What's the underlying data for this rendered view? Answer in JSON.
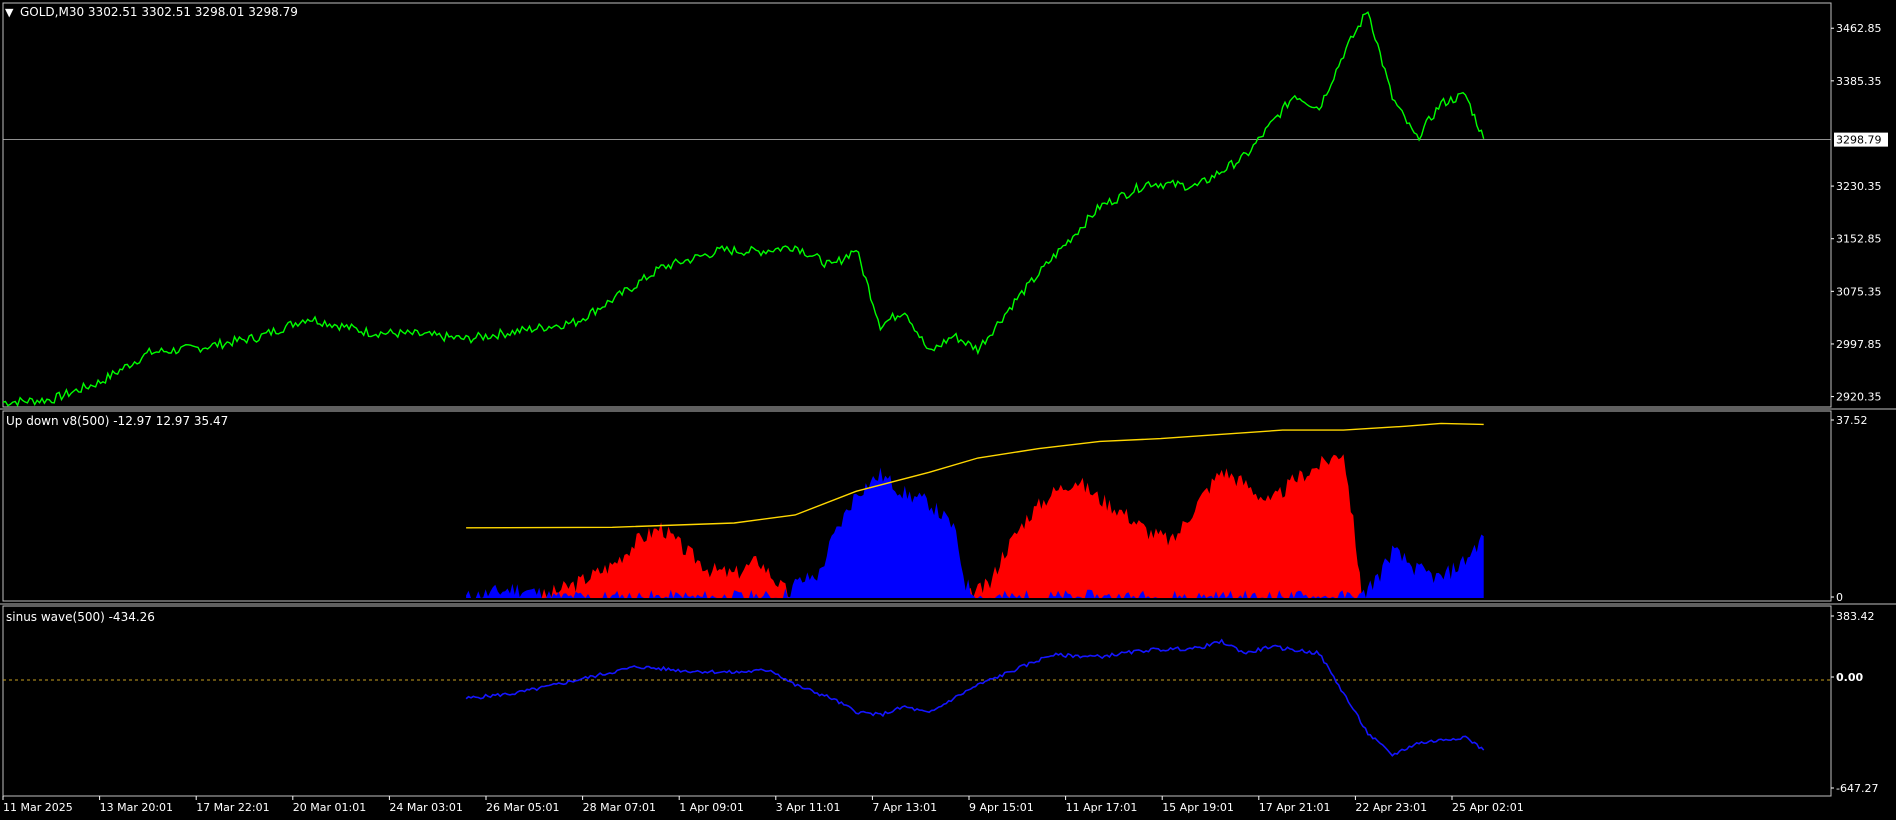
{
  "colors": {
    "background": "#000000",
    "frame": "#c0c0c0",
    "text": "#ffffff",
    "price": "#00ff00",
    "up_hist": "#ff0000",
    "down_hist": "#0000ff",
    "ma_line": "#ffd700",
    "sine": "#1515ff",
    "zero_level": "#c8a020"
  },
  "main": {
    "header_arrow": "▼",
    "header": "GOLD,M30  3302.51 3302.51 3298.01 3298.79",
    "price_labels": [
      "3462.85",
      "3385.35",
      "3230.35",
      "3152.85",
      "3075.35",
      "2997.85",
      "2920.35"
    ],
    "current_price": "3298.79"
  },
  "upd": {
    "header": "Up down v8(500) -12.97 12.97 35.47",
    "label_top": "37.52",
    "label_bottom": "0"
  },
  "sine": {
    "header": "sinus wave(500) -434.26",
    "label_top": "383.42",
    "label_zero": "0.00",
    "label_bottom": "-647.27"
  },
  "xaxis_labels": [
    "11 Mar 2025",
    "13 Mar 20:01",
    "17 Mar 22:01",
    "20 Mar 01:01",
    "24 Mar 03:01",
    "26 Mar 05:01",
    "28 Mar 07:01",
    "1 Apr 09:01",
    "3 Apr 11:01",
    "7 Apr 13:01",
    "9 Apr 15:01",
    "11 Apr 17:01",
    "15 Apr 19:01",
    "17 Apr 21:01",
    "22 Apr 23:01",
    "25 Apr 02:01"
  ],
  "chart_data": [
    {
      "type": "line",
      "title": "GOLD,M30",
      "x_range": [
        0,
        1500
      ],
      "ylim": [
        2905,
        3500
      ],
      "series": [
        {
          "name": "GOLD,M30",
          "x": [
            0,
            40,
            80,
            120,
            160,
            210,
            250,
            300,
            340,
            380,
            420,
            470,
            510,
            540,
            590,
            620,
            650,
            680,
            700,
            720,
            740,
            760,
            780,
            800,
            830,
            860,
            900,
            940,
            980,
            1020,
            1060,
            1080,
            1100,
            1120,
            1140,
            1160,
            1180,
            1200,
            1215
          ],
          "y": [
            2912,
            2916,
            2942,
            2985,
            2992,
            3008,
            3036,
            3015,
            3012,
            3005,
            3016,
            3030,
            3074,
            3110,
            3136,
            3134,
            3142,
            3112,
            3138,
            3025,
            3048,
            2985,
            3010,
            2990,
            3060,
            3122,
            3200,
            3235,
            3230,
            3275,
            3365,
            3345,
            3425,
            3490,
            3360,
            3300,
            3352,
            3365,
            3300
          ]
        }
      ]
    },
    {
      "type": "area",
      "title": "Up down v8(500)",
      "x_range": [
        0,
        1500
      ],
      "ylim": [
        0,
        37.52
      ],
      "series": [
        {
          "name": "up",
          "color": "#ff0000",
          "x": [
            440,
            470,
            500,
            520,
            540,
            560,
            580,
            600,
            620,
            640,
            650,
            790,
            810,
            820,
            840,
            860,
            880,
            900,
            920,
            940,
            960,
            980,
            1000,
            1020,
            1040,
            1060,
            1080,
            1100,
            1110,
            1115
          ],
          "y": [
            0,
            3,
            7,
            12,
            15,
            10,
            6,
            5,
            8,
            2,
            0,
            0,
            3,
            9,
            17,
            22,
            25,
            21,
            18,
            14,
            12,
            20,
            27,
            24,
            20,
            25,
            28,
            31,
            12,
            0
          ]
        },
        {
          "name": "down",
          "color": "#0000ff",
          "x": [
            380,
            400,
            420,
            440,
            450,
            640,
            650,
            670,
            680,
            700,
            720,
            740,
            760,
            780,
            790,
            800,
            1115,
            1120,
            1130,
            1140,
            1160,
            1180,
            1200,
            1215
          ],
          "y": [
            0,
            1,
            2,
            1,
            0,
            0,
            3,
            5,
            12,
            22,
            26,
            22,
            20,
            15,
            3,
            0,
            0,
            2,
            5,
            10,
            6,
            4,
            8,
            13
          ]
        },
        {
          "name": "ma",
          "color": "#ffd700",
          "x": [
            380,
            500,
            600,
            650,
            700,
            760,
            800,
            850,
            900,
            950,
            1000,
            1050,
            1100,
            1150,
            1180,
            1215
          ],
          "y": [
            14.8,
            14.9,
            15.8,
            17.5,
            22.5,
            26.5,
            29.5,
            31.5,
            33.0,
            33.6,
            34.5,
            35.4,
            35.4,
            36.2,
            36.8,
            36.6
          ]
        }
      ]
    },
    {
      "type": "line",
      "title": "sinus wave(500)",
      "x_range": [
        0,
        1500
      ],
      "ylim": [
        -647.27,
        383.42
      ],
      "series": [
        {
          "name": "sinus wave",
          "x": [
            380,
            420,
            450,
            480,
            520,
            560,
            600,
            630,
            650,
            680,
            700,
            720,
            740,
            760,
            780,
            800,
            830,
            860,
            900,
            940,
            980,
            1000,
            1020,
            1040,
            1080,
            1100,
            1120,
            1140,
            1160,
            1200,
            1215
          ],
          "y": [
            -110,
            -80,
            -35,
            15,
            80,
            55,
            45,
            60,
            -30,
            -110,
            -190,
            -210,
            -160,
            -200,
            -110,
            -30,
            60,
            150,
            140,
            180,
            190,
            230,
            160,
            200,
            160,
            -80,
            -320,
            -450,
            -380,
            -340,
            -420
          ]
        }
      ]
    }
  ]
}
